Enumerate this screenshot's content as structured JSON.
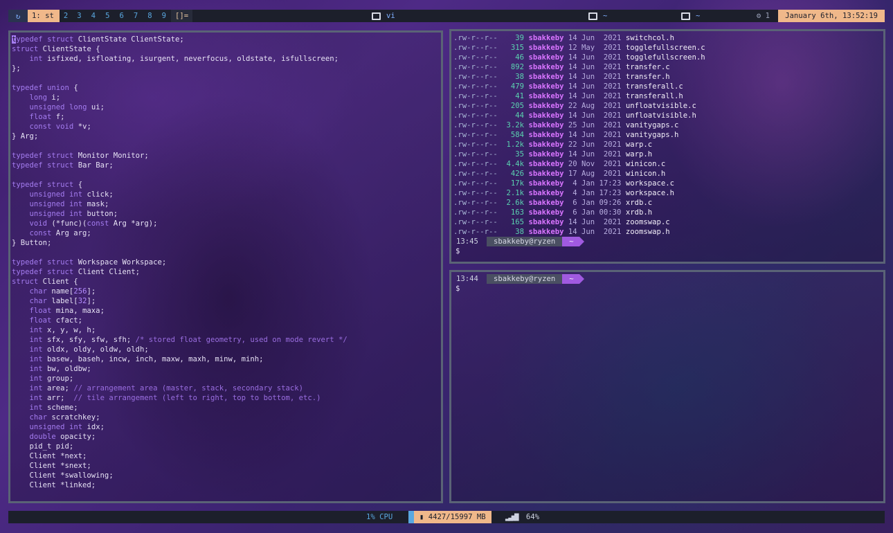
{
  "topbar": {
    "workspaces": [
      "1: st",
      "2",
      "3",
      "4",
      "5",
      "6",
      "7",
      "8",
      "9"
    ],
    "layout": "[]=",
    "windows": [
      "vi",
      "~",
      "~"
    ],
    "tray_count": "1",
    "date": "January 6th, 13:52:19"
  },
  "editor": {
    "lines": [
      "typedef struct ClientState ClientState;",
      "struct ClientState {",
      "    int isfixed, isfloating, isurgent, neverfocus, oldstate, isfullscreen;",
      "};",
      "",
      "typedef union {",
      "    long i;",
      "    unsigned long ui;",
      "    float f;",
      "    const void *v;",
      "} Arg;",
      "",
      "typedef struct Monitor Monitor;",
      "typedef struct Bar Bar;",
      "",
      "typedef struct {",
      "    unsigned int click;",
      "    unsigned int mask;",
      "    unsigned int button;",
      "    void (*func)(const Arg *arg);",
      "    const Arg arg;",
      "} Button;",
      "",
      "typedef struct Workspace Workspace;",
      "typedef struct Client Client;",
      "struct Client {",
      "    char name[256];",
      "    char label[32];",
      "    float mina, maxa;",
      "    float cfact;",
      "    int x, y, w, h;",
      "    int sfx, sfy, sfw, sfh; /* stored float geometry, used on mode revert */",
      "    int oldx, oldy, oldw, oldh;",
      "    int basew, baseh, incw, inch, maxw, maxh, minw, minh;",
      "    int bw, oldbw;",
      "    int group;",
      "    int area; // arrangement area (master, stack, secondary stack)",
      "    int arr;  // tile arrangement (left to right, top to bottom, etc.)",
      "    int scheme;",
      "    char scratchkey;",
      "    unsigned int idx;",
      "    double opacity;",
      "    pid_t pid;",
      "    Client *next;",
      "    Client *snext;",
      "    Client *swallowing;",
      "    Client *linked;"
    ]
  },
  "listing": {
    "files": [
      {
        "perm": ".rw-r--r--",
        "size": "39",
        "user": "sbakkeby",
        "day": "14",
        "mon": "Jun",
        "time": " 2021",
        "name": "switchcol.h"
      },
      {
        "perm": ".rw-r--r--",
        "size": "315",
        "user": "sbakkeby",
        "day": "12",
        "mon": "May",
        "time": " 2021",
        "name": "togglefullscreen.c"
      },
      {
        "perm": ".rw-r--r--",
        "size": "46",
        "user": "sbakkeby",
        "day": "14",
        "mon": "Jun",
        "time": " 2021",
        "name": "togglefullscreen.h"
      },
      {
        "perm": ".rw-r--r--",
        "size": "892",
        "user": "sbakkeby",
        "day": "14",
        "mon": "Jun",
        "time": " 2021",
        "name": "transfer.c"
      },
      {
        "perm": ".rw-r--r--",
        "size": "38",
        "user": "sbakkeby",
        "day": "14",
        "mon": "Jun",
        "time": " 2021",
        "name": "transfer.h"
      },
      {
        "perm": ".rw-r--r--",
        "size": "479",
        "user": "sbakkeby",
        "day": "14",
        "mon": "Jun",
        "time": " 2021",
        "name": "transferall.c"
      },
      {
        "perm": ".rw-r--r--",
        "size": "41",
        "user": "sbakkeby",
        "day": "14",
        "mon": "Jun",
        "time": " 2021",
        "name": "transferall.h"
      },
      {
        "perm": ".rw-r--r--",
        "size": "205",
        "user": "sbakkeby",
        "day": "22",
        "mon": "Aug",
        "time": " 2021",
        "name": "unfloatvisible.c"
      },
      {
        "perm": ".rw-r--r--",
        "size": "44",
        "user": "sbakkeby",
        "day": "14",
        "mon": "Jun",
        "time": " 2021",
        "name": "unfloatvisible.h"
      },
      {
        "perm": ".rw-r--r--",
        "size": "3.2k",
        "user": "sbakkeby",
        "day": "25",
        "mon": "Jun",
        "time": " 2021",
        "name": "vanitygaps.c"
      },
      {
        "perm": ".rw-r--r--",
        "size": "584",
        "user": "sbakkeby",
        "day": "14",
        "mon": "Jun",
        "time": " 2021",
        "name": "vanitygaps.h"
      },
      {
        "perm": ".rw-r--r--",
        "size": "1.2k",
        "user": "sbakkeby",
        "day": "22",
        "mon": "Jun",
        "time": " 2021",
        "name": "warp.c"
      },
      {
        "perm": ".rw-r--r--",
        "size": "35",
        "user": "sbakkeby",
        "day": "14",
        "mon": "Jun",
        "time": " 2021",
        "name": "warp.h"
      },
      {
        "perm": ".rw-r--r--",
        "size": "4.4k",
        "user": "sbakkeby",
        "day": "20",
        "mon": "Nov",
        "time": " 2021",
        "name": "winicon.c"
      },
      {
        "perm": ".rw-r--r--",
        "size": "426",
        "user": "sbakkeby",
        "day": "17",
        "mon": "Aug",
        "time": " 2021",
        "name": "winicon.h"
      },
      {
        "perm": ".rw-r--r--",
        "size": "17k",
        "user": "sbakkeby",
        "day": " 4",
        "mon": "Jan",
        "time": "17:23",
        "name": "workspace.c"
      },
      {
        "perm": ".rw-r--r--",
        "size": "2.1k",
        "user": "sbakkeby",
        "day": " 4",
        "mon": "Jan",
        "time": "17:23",
        "name": "workspace.h"
      },
      {
        "perm": ".rw-r--r--",
        "size": "2.6k",
        "user": "sbakkeby",
        "day": " 6",
        "mon": "Jan",
        "time": "09:26",
        "name": "xrdb.c"
      },
      {
        "perm": ".rw-r--r--",
        "size": "163",
        "user": "sbakkeby",
        "day": " 6",
        "mon": "Jan",
        "time": "00:30",
        "name": "xrdb.h"
      },
      {
        "perm": ".rw-r--r--",
        "size": "165",
        "user": "sbakkeby",
        "day": "14",
        "mon": "Jun",
        "time": " 2021",
        "name": "zoomswap.c"
      },
      {
        "perm": ".rw-r--r--",
        "size": "38",
        "user": "sbakkeby",
        "day": "14",
        "mon": "Jun",
        "time": " 2021",
        "name": "zoomswap.h"
      }
    ],
    "prompt_time": "13:45",
    "prompt_user": "sbakkeby@ryzen",
    "prompt_dir": "~",
    "prompt_symbol": "$"
  },
  "shell2": {
    "prompt_time": "13:44",
    "prompt_user": "sbakkeby@ryzen",
    "prompt_dir": "~",
    "prompt_symbol": "$"
  },
  "statusbar": {
    "cpu": "1% CPU",
    "mem": "4427/15997 MB",
    "wifi": "64%"
  },
  "colors": {
    "accent": "#f0b88a",
    "bar_bg": "#1c1f2b",
    "keyword": "#a47cf0",
    "user": "#d874ff",
    "prompt_dir_bg": "#a05ae0",
    "border": "#5a6376"
  }
}
